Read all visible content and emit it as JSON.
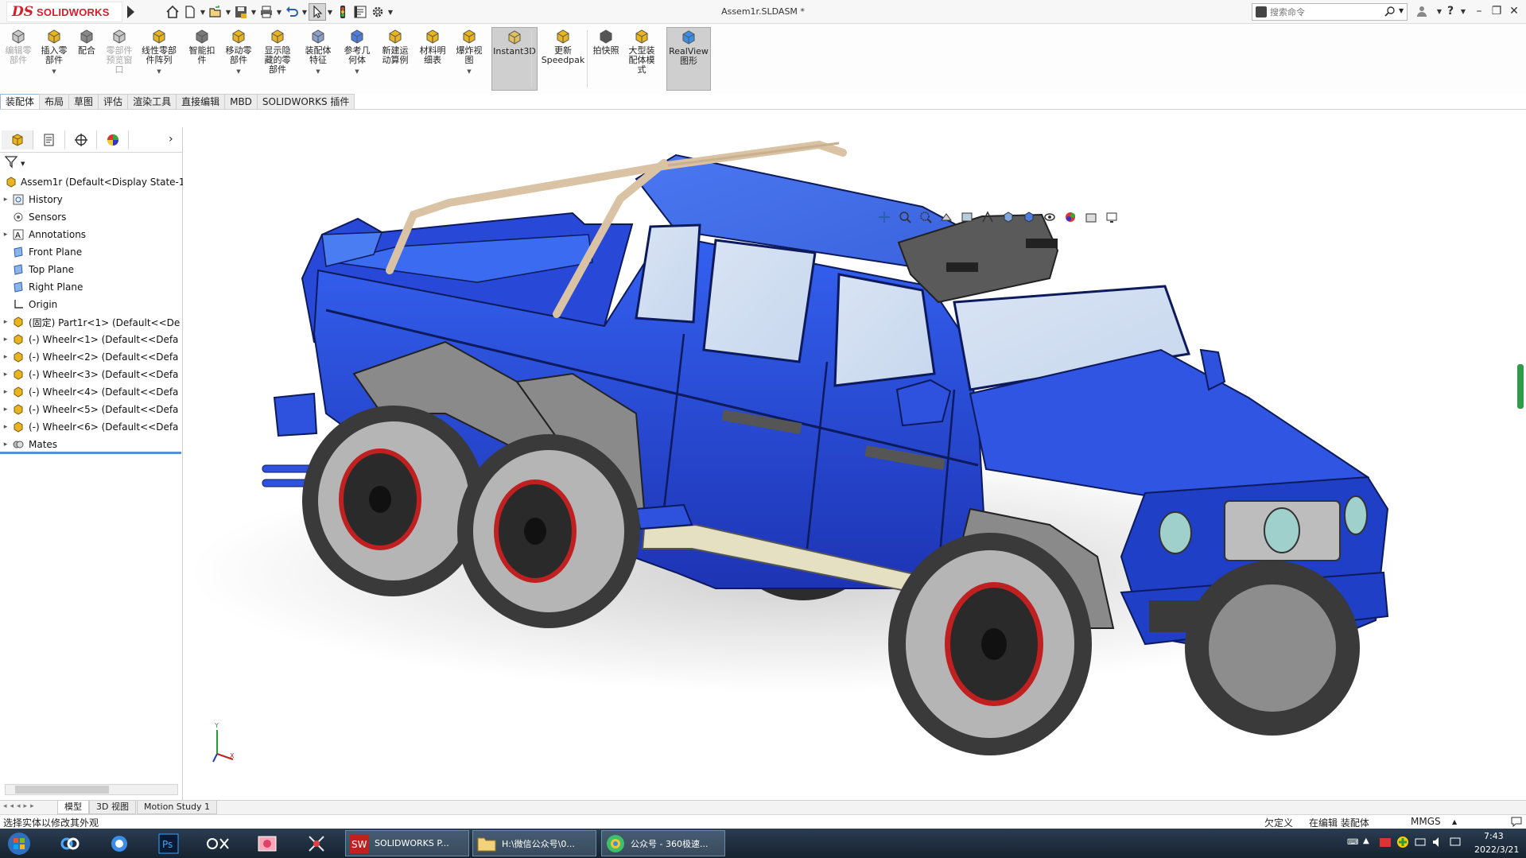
{
  "app": {
    "logo_ds": "DS",
    "logo_brand": "SOLIDWORKS",
    "document_title": "Assem1r.SLDASM *",
    "search_placeholder": "搜索命令"
  },
  "ribbon": [
    {
      "id": "edit-component",
      "label": "编辑零\n部件",
      "state": "disabled",
      "icon": "edit-component-icon"
    },
    {
      "id": "insert-component",
      "label": "插入零\n部件",
      "state": "normal",
      "icon": "insert-component-icon",
      "dropdown": true
    },
    {
      "id": "mate",
      "label": "配合",
      "state": "normal",
      "icon": "mate-icon"
    },
    {
      "id": "component-preview",
      "label": "零部件\n预览窗\n口",
      "state": "disabled",
      "icon": "preview-window-icon"
    },
    {
      "id": "linear-pattern",
      "label": "线性零部\n件阵列",
      "state": "normal",
      "icon": "linear-pattern-icon",
      "dropdown": true
    },
    {
      "id": "smart-fasteners",
      "label": "智能扣\n件",
      "state": "normal",
      "icon": "smart-fastener-icon"
    },
    {
      "id": "move-component",
      "label": "移动零\n部件",
      "state": "normal",
      "icon": "move-component-icon",
      "dropdown": true
    },
    {
      "id": "show-hidden",
      "label": "显示隐\n藏的零\n部件",
      "state": "normal",
      "icon": "show-hidden-icon"
    },
    {
      "id": "assembly-features",
      "label": "装配体\n特征",
      "state": "normal",
      "icon": "assembly-feature-icon",
      "dropdown": true
    },
    {
      "id": "reference-geometry",
      "label": "参考几\n何体",
      "state": "normal",
      "icon": "reference-geometry-icon",
      "dropdown": true
    },
    {
      "id": "new-motion-study",
      "label": "新建运\n动算例",
      "state": "normal",
      "icon": "motion-study-icon"
    },
    {
      "id": "bill-of-materials",
      "label": "材料明\n细表",
      "state": "normal",
      "icon": "bom-icon"
    },
    {
      "id": "exploded-view",
      "label": "爆炸视\n图",
      "state": "normal",
      "icon": "exploded-view-icon",
      "dropdown": true
    },
    {
      "id": "instant3d",
      "label": "Instant3D",
      "state": "active",
      "icon": "instant3d-icon"
    },
    {
      "id": "update-speedpak",
      "label": "更新\nSpeedpak",
      "state": "normal",
      "icon": "speedpak-icon"
    },
    {
      "id": "snapshot",
      "label": "拍快照",
      "state": "normal",
      "icon": "camera-icon"
    },
    {
      "id": "large-assembly-mode",
      "label": "大型装\n配体模\n式",
      "state": "normal",
      "icon": "large-assembly-icon"
    },
    {
      "id": "realview",
      "label": "RealView\n图形",
      "state": "active",
      "icon": "realview-icon"
    }
  ],
  "command_tabs": [
    "装配体",
    "布局",
    "草图",
    "评估",
    "渲染工具",
    "直接编辑",
    "MBD",
    "SOLIDWORKS 插件"
  ],
  "feature_tree": {
    "root": "Assem1r  (Default<Display State-1",
    "items": [
      {
        "label": "History",
        "icon": "history-icon",
        "expand": true
      },
      {
        "label": "Sensors",
        "icon": "sensors-icon",
        "expand": false
      },
      {
        "label": "Annotations",
        "icon": "annotations-icon",
        "expand": true
      },
      {
        "label": "Front Plane",
        "icon": "plane-icon",
        "expand": false
      },
      {
        "label": "Top Plane",
        "icon": "plane-icon",
        "expand": false
      },
      {
        "label": "Right Plane",
        "icon": "plane-icon",
        "expand": false
      },
      {
        "label": "Origin",
        "icon": "origin-icon",
        "expand": false
      },
      {
        "label": "(固定) Part1r<1> (Default<<De",
        "icon": "part-icon",
        "expand": true
      },
      {
        "label": "(-) Wheelr<1> (Default<<Defa",
        "icon": "part-icon",
        "expand": true
      },
      {
        "label": "(-) Wheelr<2> (Default<<Defa",
        "icon": "part-icon",
        "expand": true
      },
      {
        "label": "(-) Wheelr<3> (Default<<Defa",
        "icon": "part-icon",
        "expand": true
      },
      {
        "label": "(-) Wheelr<4> (Default<<Defa",
        "icon": "part-icon",
        "expand": true
      },
      {
        "label": "(-) Wheelr<5> (Default<<Defa",
        "icon": "part-icon",
        "expand": true
      },
      {
        "label": "(-) Wheelr<6> (Default<<Defa",
        "icon": "part-icon",
        "expand": true
      },
      {
        "label": "Mates",
        "icon": "mates-icon",
        "expand": true
      }
    ]
  },
  "bottom_tabs": [
    "模型",
    "3D 视图",
    "Motion Study 1"
  ],
  "status": {
    "message": "选择实体以修改其外观",
    "definition": "欠定义",
    "context": "在编辑 装配体",
    "units": "MMGS"
  },
  "taskbar": {
    "tasks": [
      {
        "label": "SOLIDWORKS P...",
        "icon": "solidworks-icon"
      },
      {
        "label": "H:\\微信公众号\\0...",
        "icon": "folder-icon"
      },
      {
        "label": "公众号 - 360极速...",
        "icon": "browser-icon"
      }
    ],
    "clock_time": "7:43",
    "clock_date": "2022/3/21"
  },
  "colors": {
    "body_blue": "#1f3fc6",
    "body_light_blue": "#3d6cf0",
    "fender_gray": "#8a8a8a",
    "roll_bar": "#d9c3a4",
    "rim_red": "#c02020",
    "logo_red": "#d4202a"
  }
}
